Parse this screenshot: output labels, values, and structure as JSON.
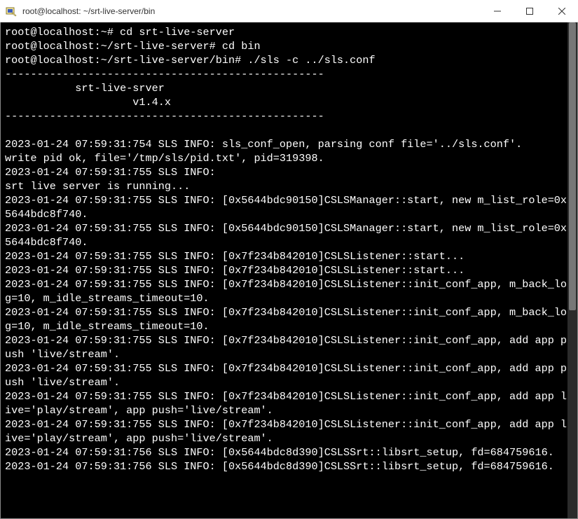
{
  "window": {
    "title": "root@localhost: ~/srt-live-server/bin"
  },
  "terminal": {
    "lines": [
      "root@localhost:~# cd srt-live-server",
      "root@localhost:~/srt-live-server# cd bin",
      "root@localhost:~/srt-live-server/bin# ./sls -c ../sls.conf",
      "--------------------------------------------------",
      "           srt-live-srver",
      "                    v1.4.x",
      "--------------------------------------------------",
      "",
      "2023-01-24 07:59:31:754 SLS INFO: sls_conf_open, parsing conf file='../sls.conf'.",
      "write pid ok, file='/tmp/sls/pid.txt', pid=319398.",
      "2023-01-24 07:59:31:755 SLS INFO:",
      "srt live server is running...",
      "2023-01-24 07:59:31:755 SLS INFO: [0x5644bdc90150]CSLSManager::start, new m_list_role=0x5644bdc8f740.",
      "2023-01-24 07:59:31:755 SLS INFO: [0x5644bdc90150]CSLSManager::start, new m_list_role=0x5644bdc8f740.",
      "2023-01-24 07:59:31:755 SLS INFO: [0x7f234b842010]CSLSListener::start...",
      "2023-01-24 07:59:31:755 SLS INFO: [0x7f234b842010]CSLSListener::start...",
      "2023-01-24 07:59:31:755 SLS INFO: [0x7f234b842010]CSLSListener::init_conf_app, m_back_log=10, m_idle_streams_timeout=10.",
      "2023-01-24 07:59:31:755 SLS INFO: [0x7f234b842010]CSLSListener::init_conf_app, m_back_log=10, m_idle_streams_timeout=10.",
      "2023-01-24 07:59:31:755 SLS INFO: [0x7f234b842010]CSLSListener::init_conf_app, add app push 'live/stream'.",
      "2023-01-24 07:59:31:755 SLS INFO: [0x7f234b842010]CSLSListener::init_conf_app, add app push 'live/stream'.",
      "2023-01-24 07:59:31:755 SLS INFO: [0x7f234b842010]CSLSListener::init_conf_app, add app live='play/stream', app push='live/stream'.",
      "2023-01-24 07:59:31:755 SLS INFO: [0x7f234b842010]CSLSListener::init_conf_app, add app live='play/stream', app push='live/stream'.",
      "2023-01-24 07:59:31:756 SLS INFO: [0x5644bdc8d390]CSLSSrt::libsrt_setup, fd=684759616.",
      "2023-01-24 07:59:31:756 SLS INFO: [0x5644bdc8d390]CSLSSrt::libsrt_setup, fd=684759616."
    ]
  }
}
